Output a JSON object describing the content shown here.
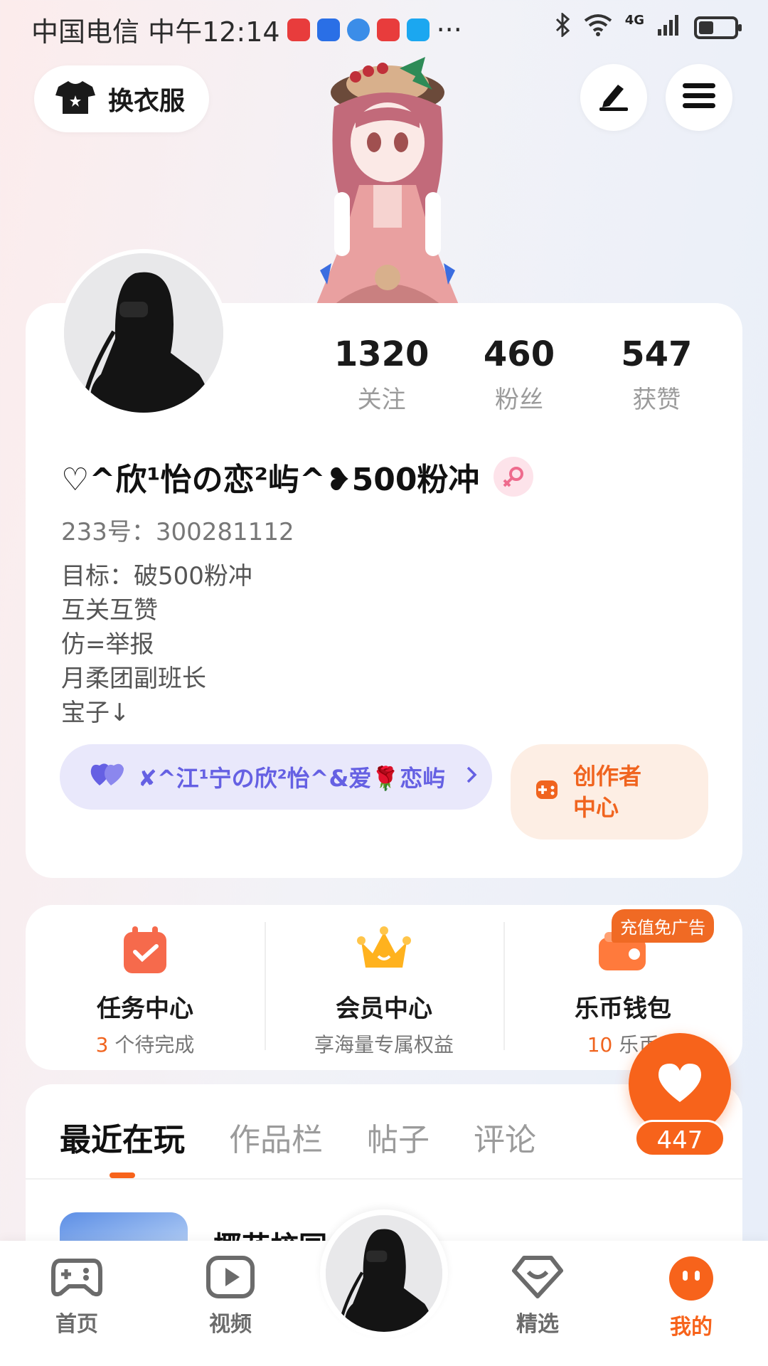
{
  "status_bar": {
    "carrier_time": "中国电信 中午12:14",
    "more": "···",
    "network": "4G"
  },
  "top": {
    "outfit_label": "换衣服"
  },
  "profile": {
    "stats": [
      {
        "value": "1320",
        "label": "关注"
      },
      {
        "value": "460",
        "label": "粉丝"
      },
      {
        "value": "547",
        "label": "获赞"
      }
    ],
    "username": "♡^欣¹怡の恋²屿^❥500粉冲",
    "uid": "233号：300281112",
    "bio": [
      "目标：破500粉冲",
      "互关互赞",
      "仿=举报",
      "月柔团副班长",
      "宝子↓"
    ],
    "relation": "✘^江¹宁の欣²怡^&爱🌹恋屿",
    "creator": "创作者中心"
  },
  "features": [
    {
      "title": "任务中心",
      "sub_num": "3",
      "sub_text": " 个待完成"
    },
    {
      "title": "会员中心",
      "sub_num": "",
      "sub_text": "享海量专属权益"
    },
    {
      "title": "乐币钱包",
      "sub_num": "10",
      "sub_text": " 乐币",
      "badge": "充值免广告"
    }
  ],
  "float_like": {
    "count": "447"
  },
  "tabs": [
    {
      "label": "最近在玩"
    },
    {
      "label": "作品栏"
    },
    {
      "label": "帖子"
    },
    {
      "label": "评论"
    }
  ],
  "recent": {
    "title": "椰花校园"
  },
  "nav": [
    {
      "label": "首页"
    },
    {
      "label": "视频"
    },
    {
      "label": "精选"
    },
    {
      "label": "我的"
    }
  ],
  "colors": {
    "accent": "#f7631b",
    "relation": "#6560e3"
  }
}
